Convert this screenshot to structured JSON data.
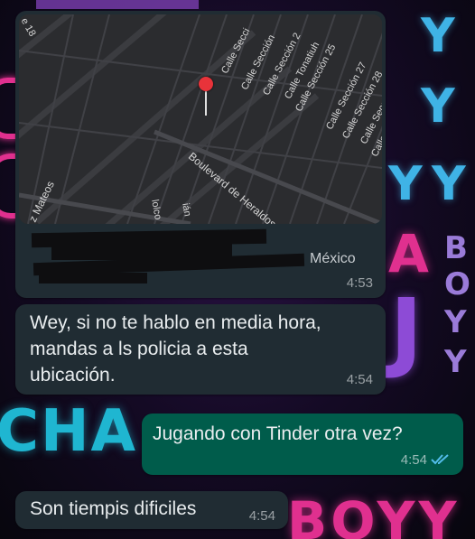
{
  "wallpaper": {
    "letters_right_y": [
      "Y",
      "Y",
      "Y",
      "Y"
    ],
    "boyy_vertical": [
      "B",
      "O",
      "Y",
      "Y"
    ],
    "neon_a": "A",
    "neon_j": "J",
    "cha": "CHA",
    "boyy_bottom": "BOYY",
    "colors": {
      "pink": "#e0308f",
      "cyan": "#1fb6d1",
      "purple": "#8d4bd6",
      "blue_y": "#3fb3e6"
    }
  },
  "location_message": {
    "map": {
      "street_labels": [
        "Calle Secci",
        "Calle Sección",
        "Calle Sección 2",
        "Calle Tonatiuh",
        "Calle Sección 25",
        "Calle Sección 27",
        "Calle Sección 28",
        "Calle Secció",
        "Calle",
        "Boulevard de Heraldos",
        "e 18",
        "z Mateos",
        "lolco",
        "ián"
      ],
      "pin_icon": "location-pin-icon"
    },
    "address_suffix": "México",
    "time": "4:53"
  },
  "messages": [
    {
      "direction": "incoming",
      "text_lines": [
        "Wey, si no te hablo en media hora,",
        "mandas a ls policia a esta",
        "ubicación."
      ],
      "time": "4:54"
    },
    {
      "direction": "outgoing",
      "text": "Jugando con Tinder otra vez?",
      "time": "4:54",
      "status_icon": "double-check-read-icon"
    },
    {
      "direction": "incoming",
      "text": "Son tiempis dificiles",
      "time": "4:54"
    }
  ],
  "colors": {
    "incoming_bubble": "#202c33",
    "outgoing_bubble": "#005c4b",
    "read_ticks": "#53bdeb",
    "map_bg": "#2b2c2f"
  }
}
